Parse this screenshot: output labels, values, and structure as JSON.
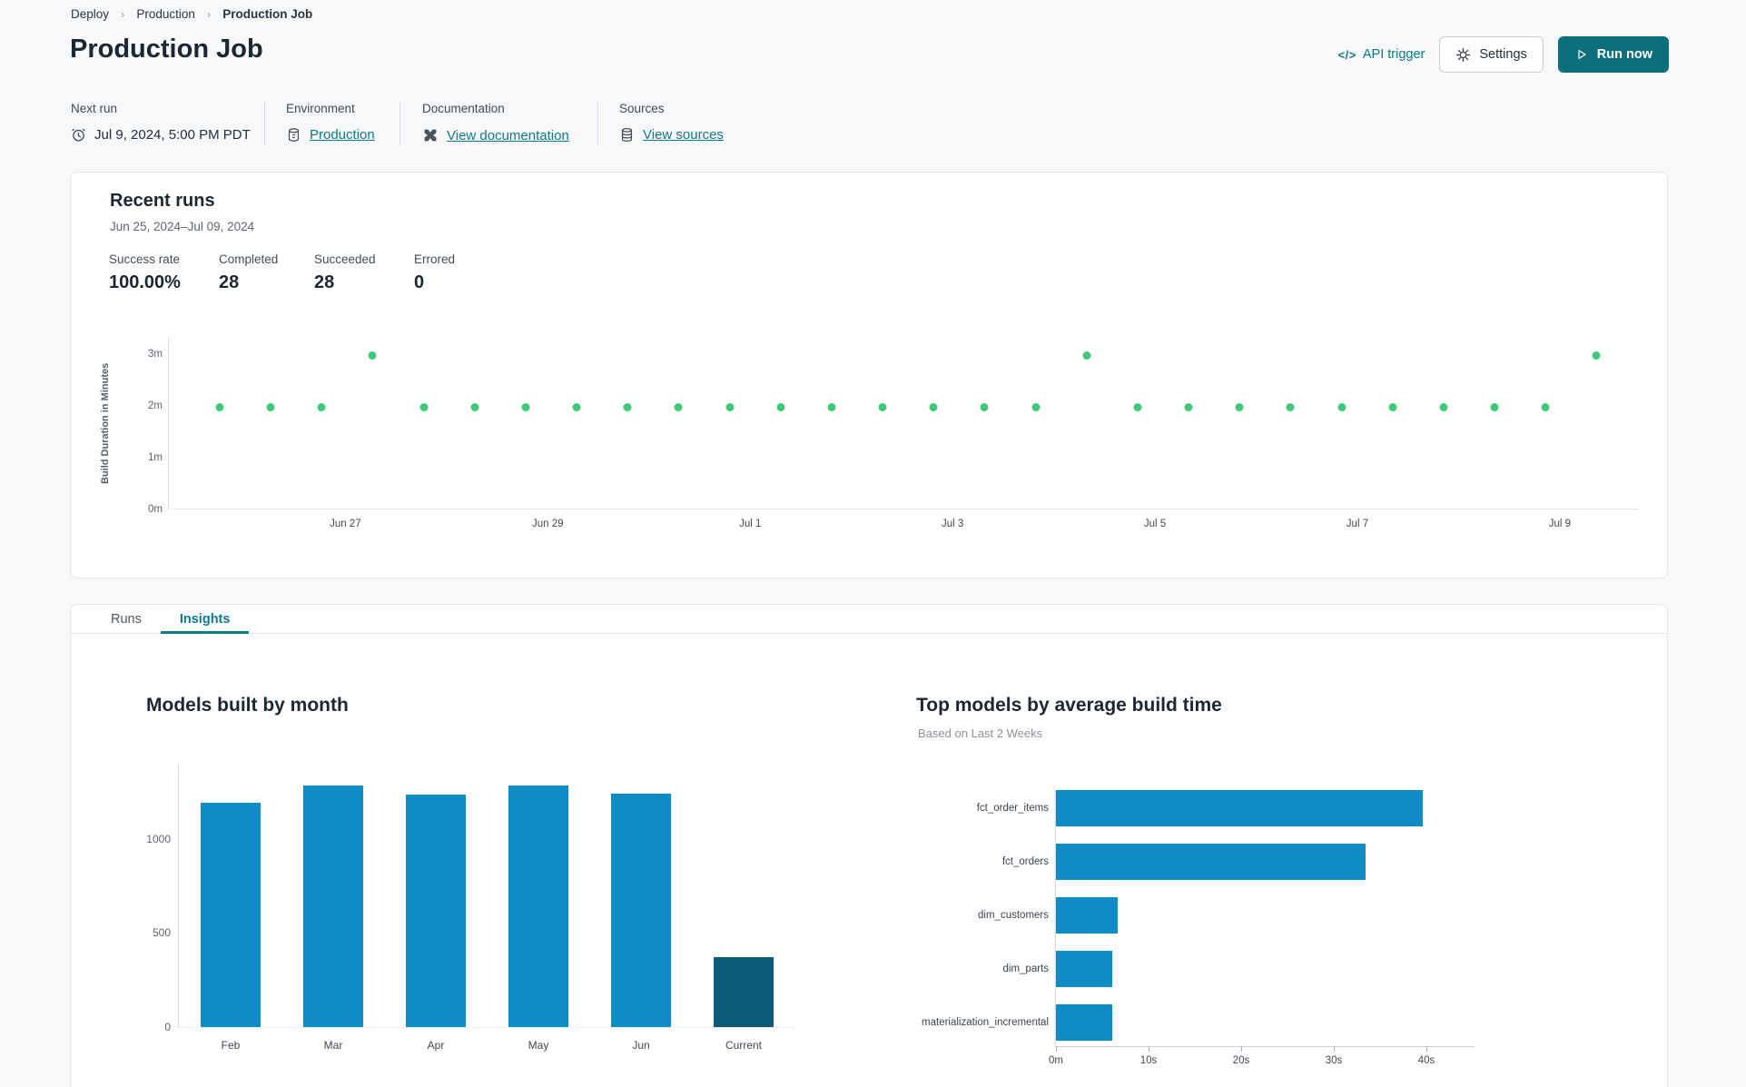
{
  "breadcrumb": {
    "items": [
      "Deploy",
      "Production",
      "Production Job"
    ]
  },
  "page_title": "Production Job",
  "actions": {
    "api_trigger_icon": "</>",
    "api_trigger_label": "API trigger",
    "settings_label": "Settings",
    "run_now_label": "Run now"
  },
  "info_bar": {
    "sections": [
      {
        "label": "Next run",
        "value": "Jul 9, 2024, 5:00 PM PDT",
        "icon": "clock-icon"
      },
      {
        "label": "Environment",
        "value": "Production",
        "icon": "database-icon"
      },
      {
        "label": "Documentation",
        "value": "View documentation",
        "icon": "dbt-icon"
      },
      {
        "label": "Sources",
        "value": "View sources",
        "icon": "database-stack-icon"
      }
    ]
  },
  "recent_runs": {
    "title": "Recent runs",
    "date_range": "Jun 25, 2024–Jul 09, 2024",
    "stats": [
      {
        "label": "Success rate",
        "value": "100.00%"
      },
      {
        "label": "Completed",
        "value": "28"
      },
      {
        "label": "Succeeded",
        "value": "28"
      },
      {
        "label": "Errored",
        "value": "0"
      }
    ]
  },
  "tabs": [
    {
      "label": "Runs",
      "active": false
    },
    {
      "label": "Insights",
      "active": true
    }
  ],
  "colors": {
    "accent_teal": "#0e7a87",
    "button_teal": "#0e6f7c",
    "run_dot_green": "#3fc878",
    "bar_blue": "#0d8cc5",
    "bar_dark_teal": "#0a5a78"
  },
  "chart_data": [
    {
      "id": "build-duration-scatter",
      "type": "scatter",
      "ylabel": "Build Duration in Minutes",
      "y_tick_labels": [
        "0m",
        "1m",
        "2m",
        "3m"
      ],
      "x_tick_labels": [
        "Jun 27",
        "Jun 29",
        "Jul 1",
        "Jul 3",
        "Jul 5",
        "Jul 7",
        "Jul 9"
      ],
      "ylim_minutes": [
        0,
        3.3
      ],
      "runs_per_day": 2,
      "point_color": "#3fc878",
      "points_minutes": [
        1.95,
        1.95,
        1.95,
        2.95,
        1.95,
        1.95,
        1.95,
        1.95,
        1.95,
        1.95,
        1.95,
        1.95,
        1.95,
        1.95,
        1.95,
        1.95,
        1.95,
        2.95,
        1.95,
        1.95,
        1.95,
        1.95,
        1.95,
        1.95,
        1.95,
        1.95,
        1.95,
        2.95
      ]
    },
    {
      "id": "models-built-by-month",
      "type": "bar",
      "title": "Models built by month",
      "categories": [
        "Feb",
        "Mar",
        "Apr",
        "May",
        "Jun",
        "Current"
      ],
      "values": [
        1190,
        1285,
        1235,
        1285,
        1240,
        370
      ],
      "y_tick_values": [
        0,
        500,
        1000
      ],
      "ylim": [
        0,
        1400
      ],
      "grid": false,
      "bar_colors": [
        "#0d8cc5",
        "#0d8cc5",
        "#0d8cc5",
        "#0d8cc5",
        "#0d8cc5",
        "#0a5a78"
      ]
    },
    {
      "id": "top-models-by-build-time",
      "type": "bar",
      "orientation": "horizontal",
      "title": "Top models by average build time",
      "subtitle": "Based on Last 2 Weeks",
      "categories": [
        "fct_order_items",
        "fct_orders",
        "dim_customers",
        "dim_parts",
        "materialization_incremental"
      ],
      "values_seconds": [
        39.6,
        33.4,
        6.7,
        6.1,
        6.1
      ],
      "x_tick_labels": [
        "0m",
        "10s",
        "20s",
        "30s",
        "40s"
      ],
      "x_tick_seconds": [
        0,
        10,
        20,
        30,
        40
      ],
      "xlim_seconds": [
        0,
        45
      ],
      "bar_color": "#0d8cc5"
    }
  ]
}
